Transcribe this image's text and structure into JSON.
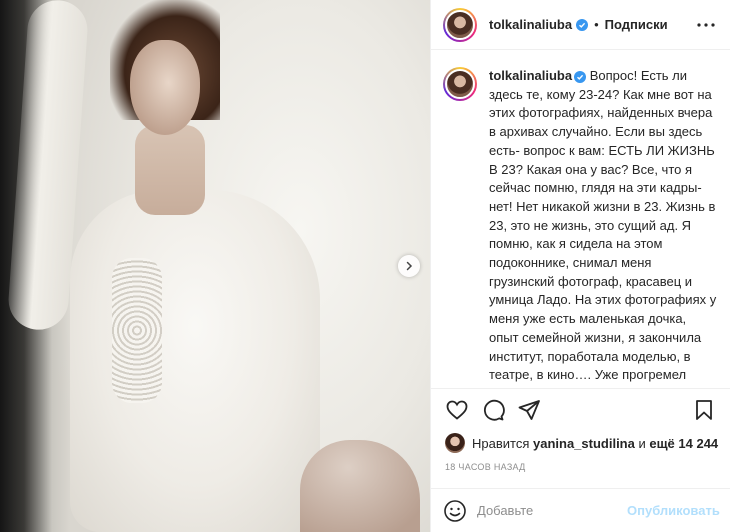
{
  "post": {
    "username": "tolkalinaliuba",
    "follow_label": "Подписки",
    "separator": "•",
    "caption_username": "tolkalinaliuba",
    "caption_text": " Вопрос! Есть ли здесь те, кому 23-24? Как мне вот на этих фотографиях, найденных вчера в архивах случайно. Если вы здесь есть- вопрос к вам: ЕСТЬ ЛИ ЖИЗНЬ В 23? Какая она у вас? Все, что я сейчас помню, глядя на эти кадры- нет! Нет никакой жизни в 23. Жизнь в 23, это не жизнь, это сущий ад. Я помню, как я сидела на этом подоконнике, снимал меня грузинский фотограф, красавец и умница Ладо. На этих фотографиях у меня уже есть маленькая дочка, опыт семейной жизни, я закончила институт, поработала моделью, в театре, в кино…. Уже прогремел Антикиллер. и я невероятно несчастлива. Я - самое несчастное",
    "likes_prefix": "Нравится ",
    "likes_user": "yanina_studilina",
    "likes_middle": " и ",
    "likes_more": "ещё 14 244",
    "timestamp": "18 часов назад"
  },
  "comment": {
    "placeholder": "Добавьте",
    "publish_label": "Опубликовать"
  },
  "colors": {
    "accent": "#3897f0",
    "publish_disabled": "#b2dffc",
    "muted": "#8e8e8e",
    "text": "#262626"
  },
  "icons": [
    "more-icon",
    "verified-icon",
    "heart-icon",
    "comment-icon",
    "share-icon",
    "bookmark-icon",
    "emoji-icon",
    "chevron-right-icon"
  ]
}
